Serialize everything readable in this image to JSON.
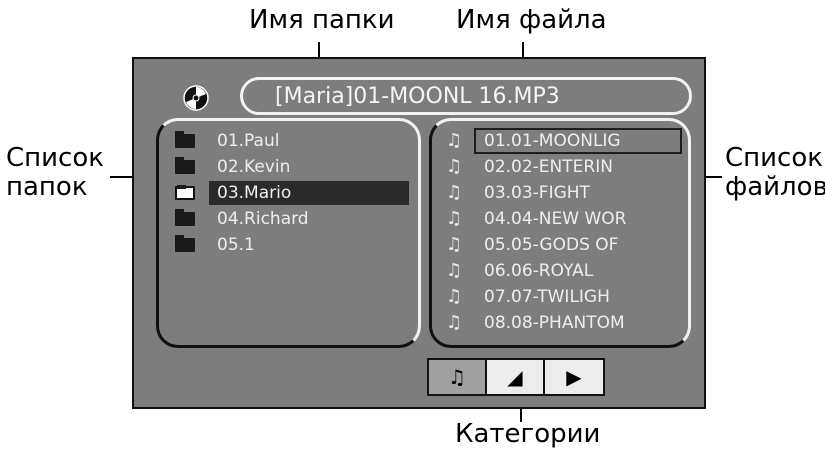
{
  "callouts": {
    "folder_name": "Имя папки",
    "file_name": "Имя файла",
    "folder_list_line1": "Список",
    "folder_list_line2": "папок",
    "file_list_line1": "Список",
    "file_list_line2": "файлов",
    "categories": "Категории"
  },
  "screen": {
    "current_track": "[Maria]01-MOONL 16.MP3",
    "folders": [
      {
        "label": "01.Paul",
        "selected": false
      },
      {
        "label": "02.Kevin",
        "selected": false
      },
      {
        "label": "03.Mario",
        "selected": true
      },
      {
        "label": "04.Richard",
        "selected": false
      },
      {
        "label": "05.1",
        "selected": false
      }
    ],
    "files": [
      {
        "label": "01.01-MOONLIG",
        "selected": true
      },
      {
        "label": "02.02-ENTERIN",
        "selected": false
      },
      {
        "label": "03.03-FIGHT",
        "selected": false
      },
      {
        "label": "04.04-NEW WOR",
        "selected": false
      },
      {
        "label": "05.05-GODS OF",
        "selected": false
      },
      {
        "label": "06.06-ROYAL",
        "selected": false
      },
      {
        "label": "07.07-TWILIGH",
        "selected": false
      },
      {
        "label": "08.08-PHANTOM",
        "selected": false
      }
    ],
    "tabs": [
      {
        "icon": "music-note-icon",
        "glyph": "♫",
        "active": true
      },
      {
        "icon": "photo-icon",
        "glyph": "◢",
        "active": false
      },
      {
        "icon": "play-icon",
        "glyph": "▶",
        "active": false
      }
    ]
  }
}
